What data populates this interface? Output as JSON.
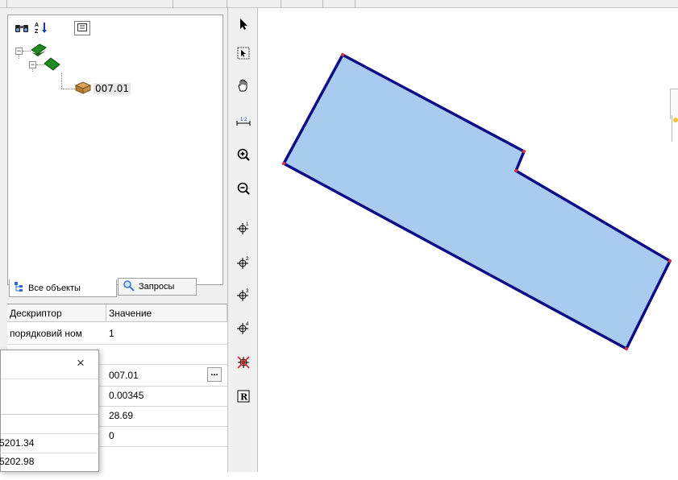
{
  "tree": {
    "node_label": "007.01"
  },
  "tabs": [
    {
      "label": "Все объекты"
    },
    {
      "label": "Запросы"
    }
  ],
  "grid": {
    "headers": [
      "Дескриптор",
      "Значение"
    ],
    "rows": [
      {
        "descriptor": "порядковий ном",
        "value": "1"
      },
      {
        "descriptor": "",
        "value": ""
      },
      {
        "descriptor": "",
        "value": "007.01"
      },
      {
        "descriptor": "",
        "value": "0.00345"
      },
      {
        "descriptor": "",
        "value": "28.69"
      },
      {
        "descriptor": "",
        "value": "0"
      }
    ],
    "ellipsis_label": "..."
  },
  "dialog": {
    "close_label": "×",
    "values": [
      "5201.34",
      "5202.98"
    ]
  },
  "colors": {
    "polygon_fill": "#a9cbef",
    "polygon_stroke": "#0d0d86",
    "vertex": "#e0303a"
  }
}
